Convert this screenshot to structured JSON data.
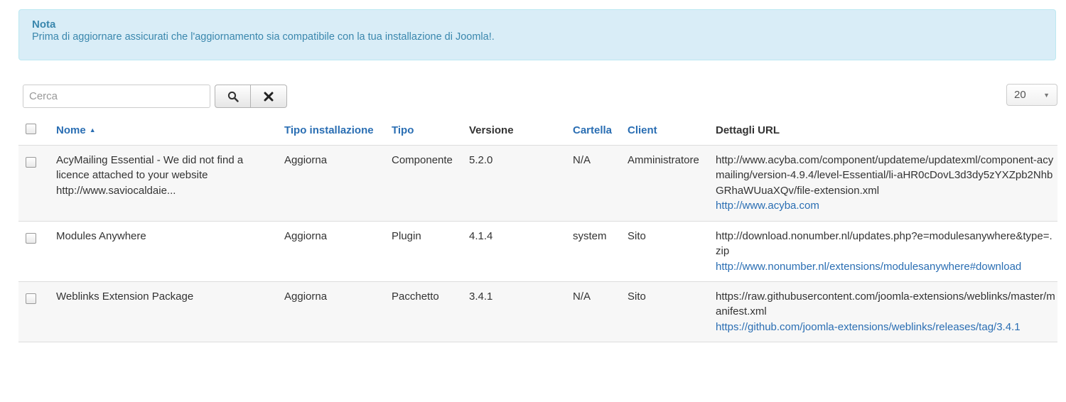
{
  "alert": {
    "heading": "Nota",
    "message": "Prima di aggiornare assicurati che l'aggiornamento sia compatibile con la tua installazione di Joomla!."
  },
  "search": {
    "placeholder": "Cerca",
    "value": "",
    "search_icon": "search-icon",
    "clear_icon": "close-icon"
  },
  "list_limit": {
    "value": "20"
  },
  "table": {
    "columns": {
      "name": "Nome",
      "install_type": "Tipo installazione",
      "type": "Tipo",
      "version": "Versione",
      "folder": "Cartella",
      "client": "Client",
      "details_url": "Dettagli URL"
    },
    "sort_indicator": "▲",
    "rows": [
      {
        "name": "AcyMailing Essential - We did not find a licence attached to your website http://www.saviocaldaie...",
        "install_type": "Aggiorna",
        "type": "Componente",
        "version": "5.2.0",
        "folder": "N/A",
        "client": "Amministratore",
        "details_url": "http://www.acyba.com/component/updateme/updatexml/component-acymailing/version-4.9.4/level-Essential/li-aHR0cDovL3d3dy5zYXZpb2NhbGRhaWUuaXQv/file-extension.xml",
        "info_url": "http://www.acyba.com"
      },
      {
        "name": "Modules Anywhere",
        "install_type": "Aggiorna",
        "type": "Plugin",
        "version": "4.1.4",
        "folder": "system",
        "client": "Sito",
        "details_url": "http://download.nonumber.nl/updates.php?e=modulesanywhere&type=.zip",
        "info_url": "http://www.nonumber.nl/extensions/modulesanywhere#download"
      },
      {
        "name": "Weblinks Extension Package",
        "install_type": "Aggiorna",
        "type": "Pacchetto",
        "version": "3.4.1",
        "folder": "N/A",
        "client": "Sito",
        "details_url": "https://raw.githubusercontent.com/joomla-extensions/weblinks/master/manifest.xml",
        "info_url": "https://github.com/joomla-extensions/weblinks/releases/tag/3.4.1"
      }
    ]
  }
}
